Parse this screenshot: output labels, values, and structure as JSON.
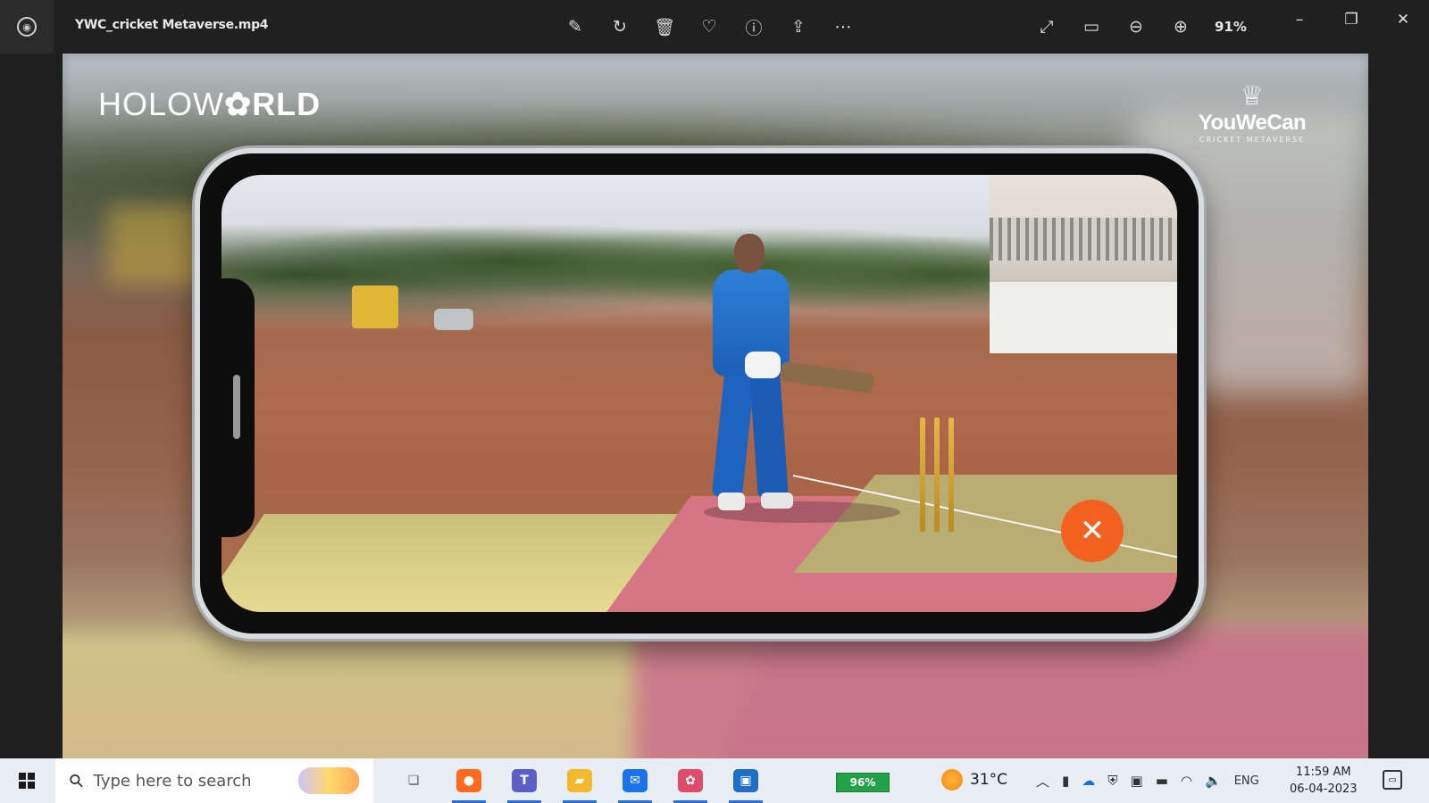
{
  "window": {
    "title": "YWC_cricket Metaverse.mp4",
    "zoom": "91%",
    "toolbar": [
      {
        "name": "edit-image-icon",
        "glyph": "✎"
      },
      {
        "name": "rotate-icon",
        "glyph": "↻"
      },
      {
        "name": "delete-icon",
        "glyph": "🗑"
      },
      {
        "name": "favorite-icon",
        "glyph": "♡"
      },
      {
        "name": "info-icon",
        "glyph": "ⓘ"
      },
      {
        "name": "share-icon",
        "glyph": "⇪"
      },
      {
        "name": "more-icon",
        "glyph": "⋯"
      }
    ],
    "view_tools": [
      {
        "name": "fullscreen-icon",
        "glyph": "⤢"
      },
      {
        "name": "fit-view-icon",
        "glyph": "▭"
      },
      {
        "name": "zoom-out-icon",
        "glyph": "⊖"
      },
      {
        "name": "zoom-in-icon",
        "glyph": "⊕"
      }
    ],
    "controls": {
      "minimize": "–",
      "restore": "❐",
      "close": "✕"
    }
  },
  "video": {
    "brand_left_light": "HOLOW",
    "brand_left_bold": "RLD",
    "brand_left_symbol": "✿",
    "brand_right_name": "YouWeCan",
    "brand_right_sub": "CRICKET METAVERSE",
    "brand_right_mark": "♕",
    "close_glyph": "✕"
  },
  "taskbar": {
    "search_placeholder": "Type here to search",
    "apps": [
      {
        "name": "task-view-icon",
        "glyph": "❏",
        "color": "#5b5b5b"
      },
      {
        "name": "firefox-icon",
        "glyph": "●",
        "color": "#ff6a1f"
      },
      {
        "name": "teams-icon",
        "glyph": "T",
        "color": "#5b5fc7"
      },
      {
        "name": "file-explorer-icon",
        "glyph": "▰",
        "color": "#f4b82c"
      },
      {
        "name": "mail-icon",
        "glyph": "✉",
        "color": "#1a73e8"
      },
      {
        "name": "app-icon",
        "glyph": "✿",
        "color": "#e04b6a"
      },
      {
        "name": "photos-icon",
        "glyph": "▣",
        "color": "#1f6fc9"
      }
    ],
    "battery": "96%",
    "temperature": "31°C",
    "language": "ENG",
    "time": "11:59 AM",
    "date": "06-04-2023"
  }
}
